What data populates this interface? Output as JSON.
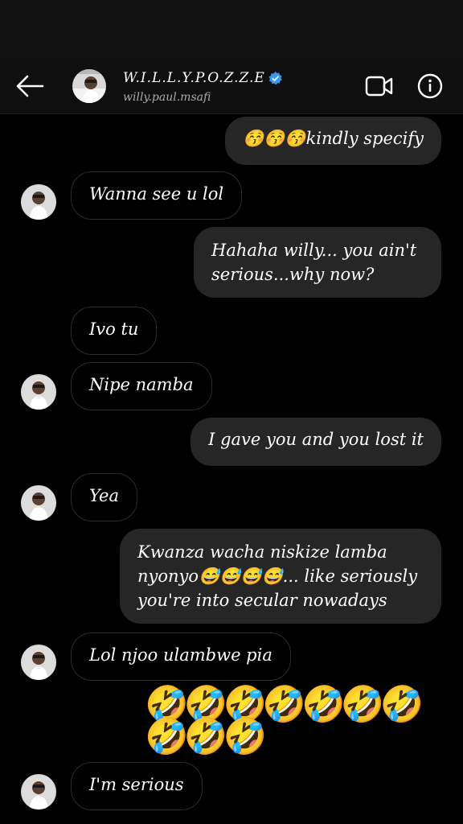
{
  "header": {
    "display_name": "W.I.L.L.Y.P.O.Z.Z.E",
    "username": "willy.paul.msafi"
  },
  "icons": {
    "back": "arrow-left-icon",
    "verified": "verified-badge-icon",
    "video": "video-camera-icon",
    "info": "info-icon"
  },
  "messages": [
    {
      "side": "out",
      "text": "😚😚😚kindly specify"
    },
    {
      "side": "in",
      "text": "Wanna see u lol"
    },
    {
      "side": "out",
      "text": "Hahaha willy... you ain't serious...why now?"
    },
    {
      "side": "in",
      "text": "Ivo tu"
    },
    {
      "side": "in",
      "text": "Nipe namba"
    },
    {
      "side": "out",
      "text": "I gave you and you lost it"
    },
    {
      "side": "in",
      "text": "Yea"
    },
    {
      "side": "out",
      "text": "Kwanza wacha niskize lamba nyonyo😅😅😅😅... like seriously you're into secular nowadays"
    },
    {
      "side": "in",
      "text": "Lol njoo ulambwe pia"
    },
    {
      "side": "out",
      "text": "🤣🤣🤣🤣🤣🤣🤣🤣🤣🤣"
    },
    {
      "side": "in",
      "text": "I'm serious"
    }
  ],
  "colors": {
    "background": "#000000",
    "outgoing_bubble": "#262626",
    "incoming_border": "#2c2c2c",
    "verified": "#3897f0"
  }
}
